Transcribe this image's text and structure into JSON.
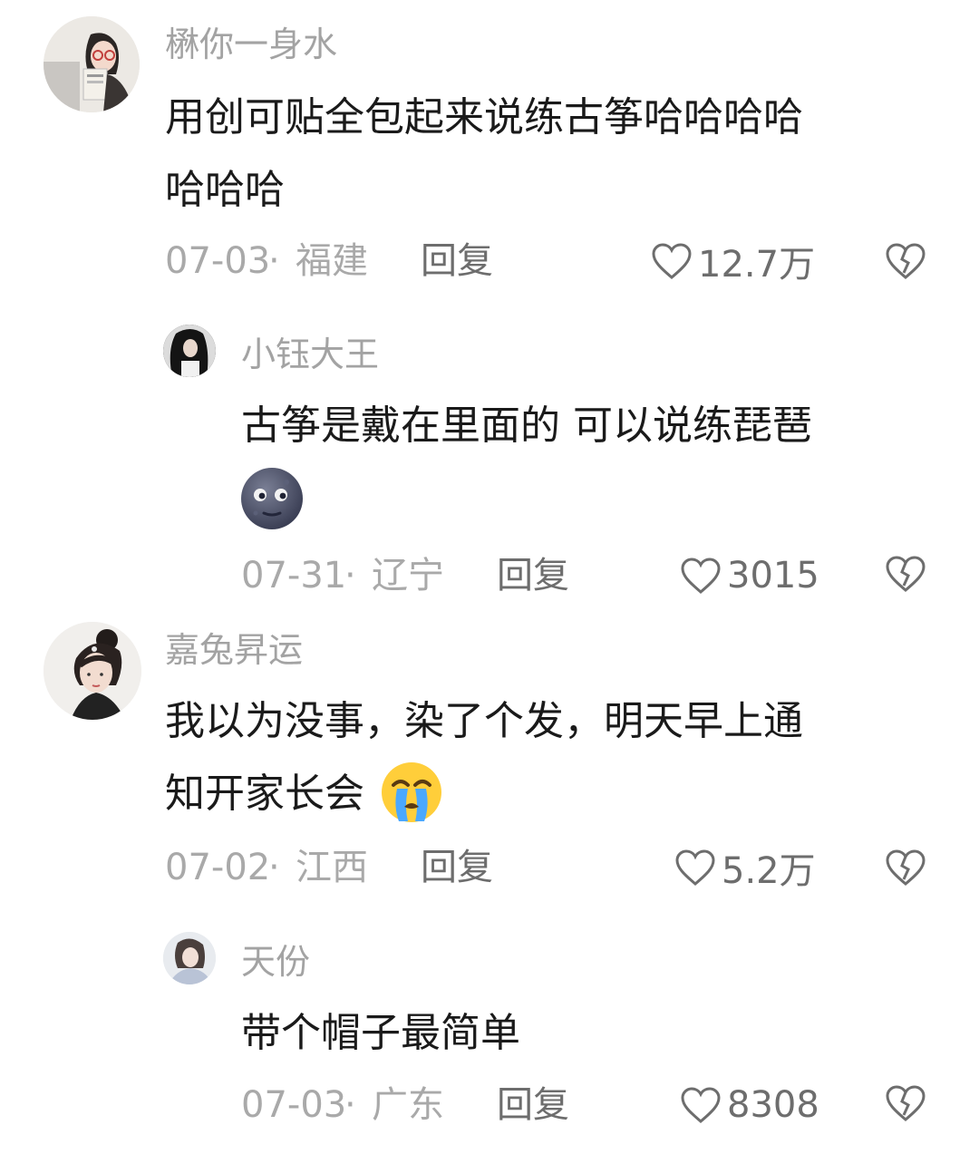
{
  "comments": [
    {
      "username": "楙你一身水",
      "text_lines": [
        "用创可贴全包起来说练古筝哈哈哈哈",
        "哈哈哈"
      ],
      "date": "07-03",
      "location": "福建",
      "reply_label": "回复",
      "likes": "12.7万",
      "avatar_icon": "avatar-woman-glasses-reading",
      "replies": [
        {
          "username": "小钰大王",
          "text_lines": [
            "古筝是戴在里面的 可以说练琵琶"
          ],
          "trailing_emoji": "new-moon-face-emoji",
          "date": "07-31",
          "location": "辽宁",
          "reply_label": "回复",
          "likes": "3015",
          "avatar_icon": "avatar-dark-portrait"
        }
      ]
    },
    {
      "username": "嘉兔昇运",
      "text_lines": [
        "我以为没事，染了个发，明天早上通",
        "知开家长会"
      ],
      "trailing_emoji": "crying-face-emoji",
      "date": "07-02",
      "location": "江西",
      "reply_label": "回复",
      "likes": "5.2万",
      "avatar_icon": "avatar-woman-updo",
      "replies": [
        {
          "username": "天份",
          "text_lines": [
            "带个帽子最简单"
          ],
          "date": "07-03",
          "location": "广东",
          "reply_label": "回复",
          "likes": "8308",
          "avatar_icon": "avatar-portrait-light"
        }
      ]
    }
  ],
  "colors": {
    "username": "#a3a3a3",
    "text": "#1a1a1a",
    "meta": "#a9a9a9",
    "action": "#6d6d6d"
  }
}
